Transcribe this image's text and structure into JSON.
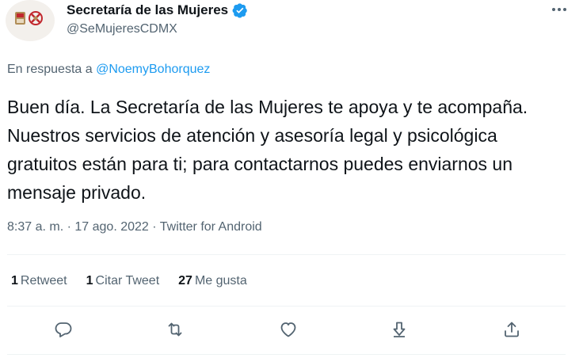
{
  "account": {
    "display_name": "Secretaría de las Mujeres",
    "handle": "@SeMujeresCDMX",
    "verified": true
  },
  "reply": {
    "prefix": "En respuesta a",
    "mention": "@NoemyBohorquez"
  },
  "tweet": {
    "text": "Buen día. La Secretaría de las Mujeres te apoya y te acompaña. Nuestros servicios de atención y asesoría legal y psicológica gratuitos están para ti; para contactarnos puedes enviarnos un mensaje privado.",
    "time": "8:37 a. m.",
    "separator": "·",
    "date": "17 ago. 2022",
    "source": "Twitter for Android"
  },
  "stats": {
    "retweets_count": "1",
    "retweets_label": "Retweet",
    "quotes_count": "1",
    "quotes_label": "Citar Tweet",
    "likes_count": "27",
    "likes_label": "Me gusta"
  },
  "icons": {
    "more": "more-icon",
    "reply": "reply-icon",
    "retweet": "retweet-icon",
    "like": "heart-icon",
    "share": "share-icon",
    "upload": "upload-icon",
    "verified": "verified-badge-icon"
  },
  "colors": {
    "accent": "#1d9bf0",
    "secondary_text": "#536471",
    "primary_text": "#0f1419",
    "avatar_red": "#c1272d",
    "avatar_gold": "#b08d57"
  }
}
